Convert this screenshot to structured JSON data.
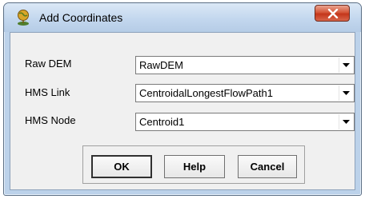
{
  "window": {
    "title": "Add Coordinates",
    "icon": "globe-pin-icon",
    "close_icon": "close-icon"
  },
  "fields": [
    {
      "label": "Raw DEM",
      "value": "RawDEM"
    },
    {
      "label": "HMS Link",
      "value": "CentroidalLongestFlowPath1"
    },
    {
      "label": "HMS Node",
      "value": "Centroid1"
    }
  ],
  "buttons": {
    "ok": "OK",
    "help": "Help",
    "cancel": "Cancel"
  },
  "colors": {
    "title_bar": "#c3d7ee",
    "client": "#f0f0f0",
    "close_button": "#c4361b"
  }
}
